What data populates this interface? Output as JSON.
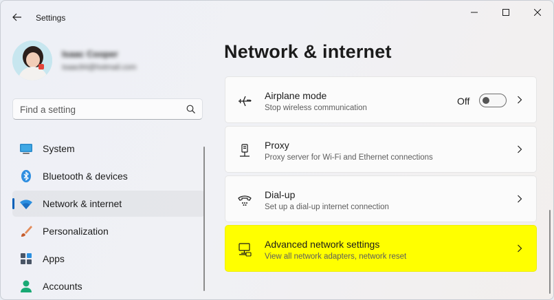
{
  "window": {
    "title": "Settings"
  },
  "profile": {
    "name": "Isaac Cooper",
    "email": "isaac84@hotmail.com"
  },
  "search": {
    "placeholder": "Find a setting"
  },
  "sidebar": {
    "items": [
      {
        "label": "System",
        "icon": "system-icon"
      },
      {
        "label": "Bluetooth & devices",
        "icon": "bluetooth-icon"
      },
      {
        "label": "Network & internet",
        "icon": "wifi-icon",
        "selected": true
      },
      {
        "label": "Personalization",
        "icon": "brush-icon"
      },
      {
        "label": "Apps",
        "icon": "apps-icon"
      },
      {
        "label": "Accounts",
        "icon": "accounts-icon"
      }
    ]
  },
  "main": {
    "title": "Network & internet",
    "cards": [
      {
        "title": "Airplane mode",
        "subtitle": "Stop wireless communication",
        "toggle_label": "Off",
        "icon": "airplane-icon"
      },
      {
        "title": "Proxy",
        "subtitle": "Proxy server for Wi-Fi and Ethernet connections",
        "icon": "proxy-icon"
      },
      {
        "title": "Dial-up",
        "subtitle": "Set up a dial-up internet connection",
        "icon": "dialup-icon"
      },
      {
        "title": "Advanced network settings",
        "subtitle": "View all network adapters, network reset",
        "icon": "advanced-network-icon",
        "highlighted": true
      }
    ]
  },
  "colors": {
    "accent": "#005fb8",
    "highlight": "#ffff00"
  }
}
